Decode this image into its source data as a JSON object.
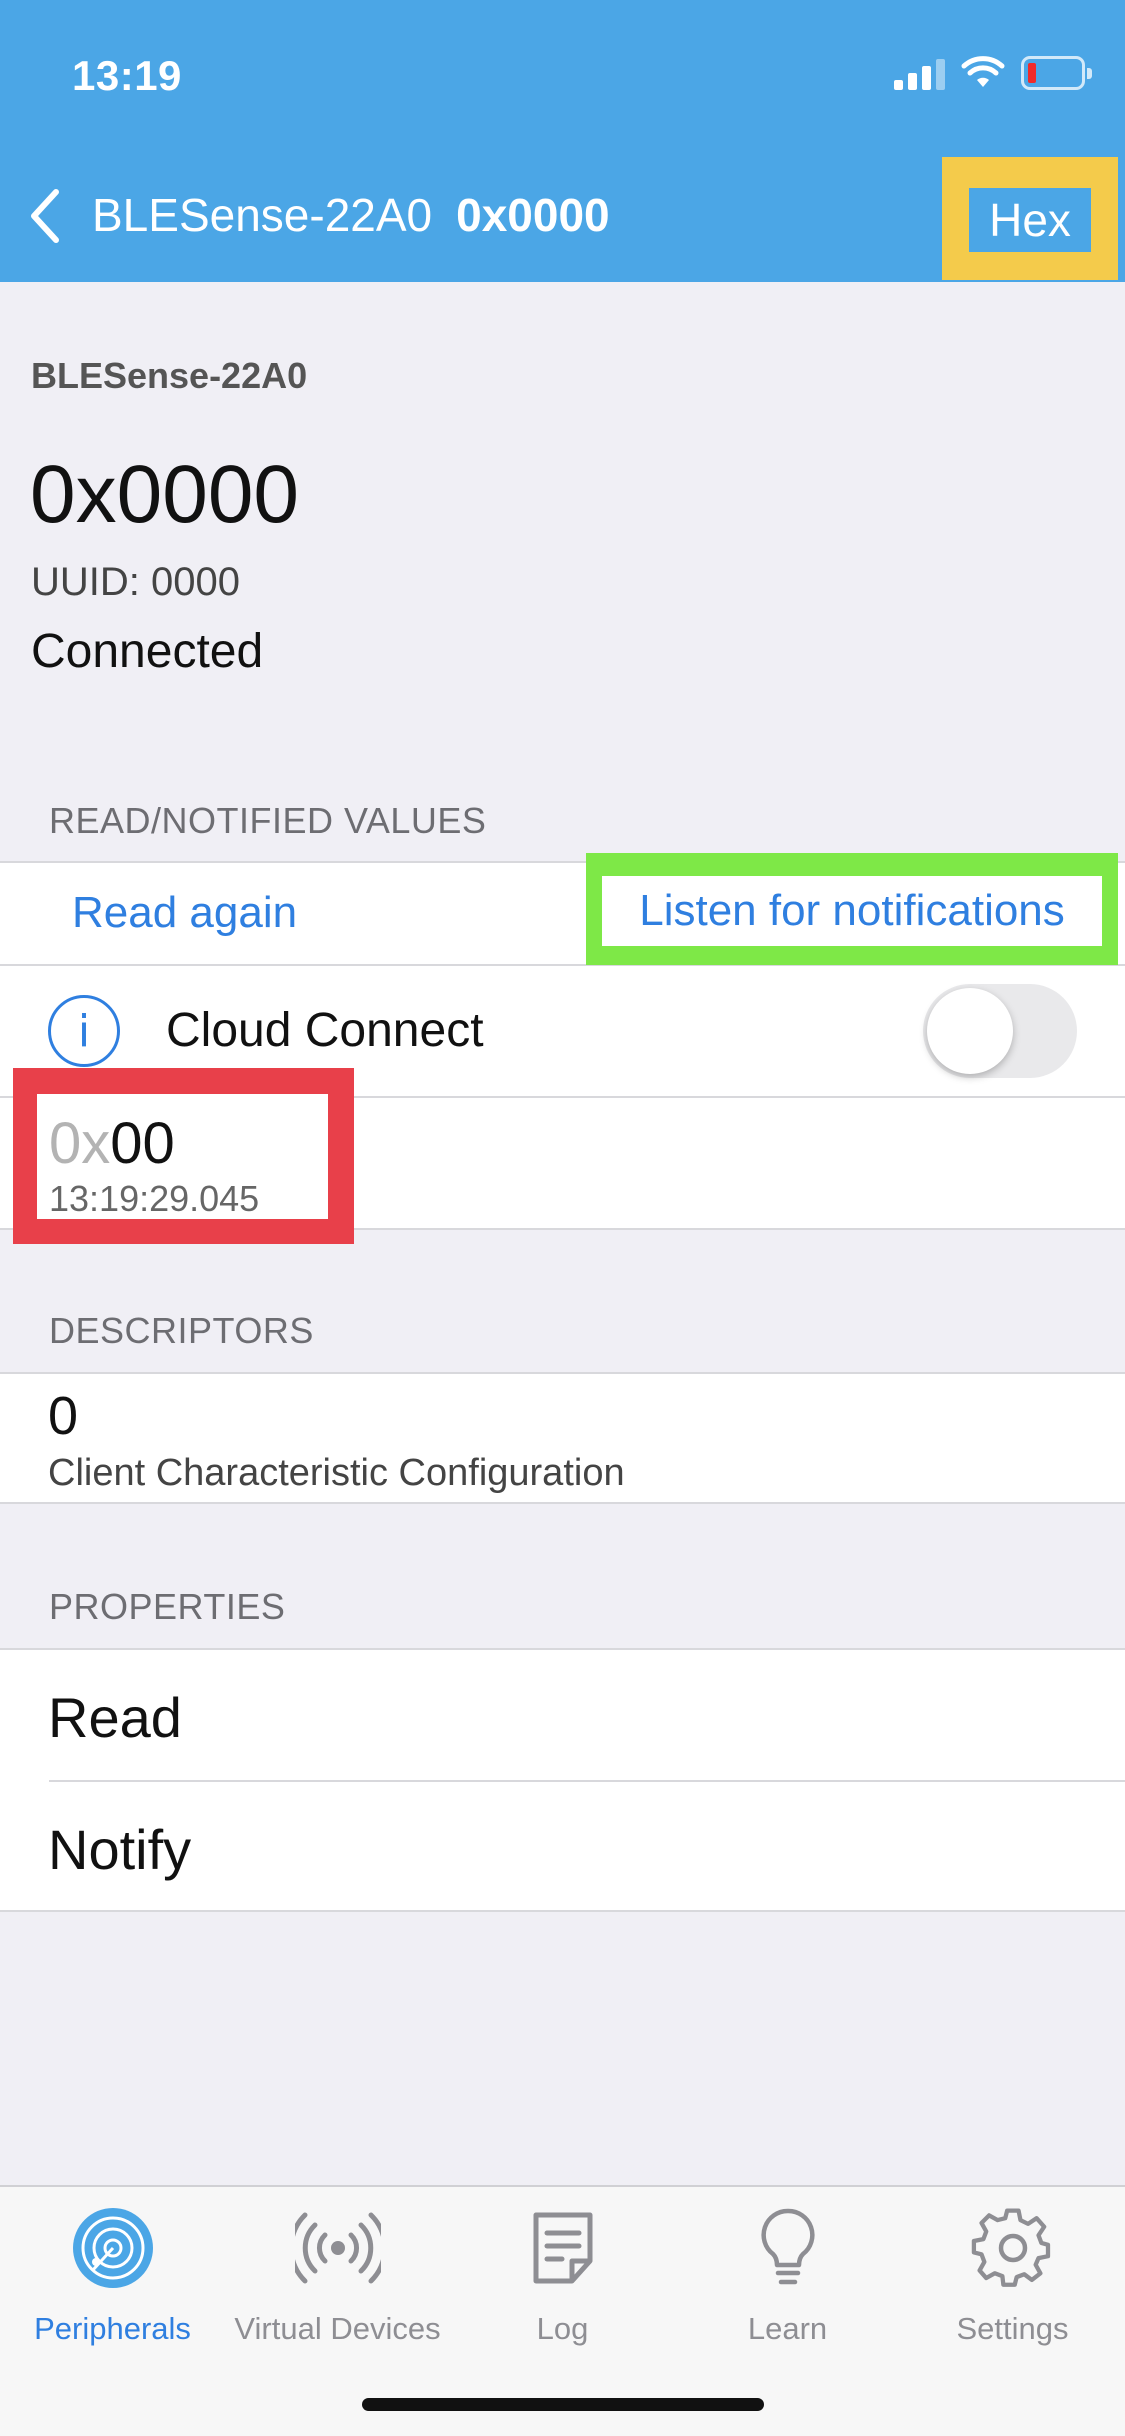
{
  "status_bar": {
    "time": "13:19"
  },
  "nav": {
    "device_name": "BLESense-22A0",
    "characteristic": "0x0000",
    "hex_label": "Hex"
  },
  "header": {
    "device_name": "BLESense-22A0",
    "characteristic": "0x0000",
    "uuid": "UUID: 0000",
    "state": "Connected"
  },
  "read_section": {
    "title": "READ/NOTIFIED VALUES",
    "read_again_label": "Read again",
    "listen_label": "Listen for notifications",
    "cloud_connect_label": "Cloud Connect",
    "cloud_connect_on": false,
    "value_prefix": "0x",
    "value": "00",
    "value_time": "13:19:29.045"
  },
  "descriptors": {
    "title": "DESCRIPTORS",
    "items": [
      {
        "name": "0",
        "detail": "Client Characteristic Configuration"
      }
    ]
  },
  "properties": {
    "title": "PROPERTIES",
    "items": [
      "Read",
      "Notify"
    ]
  },
  "tabbar": {
    "active": "Peripherals",
    "tabs": [
      {
        "label": "Peripherals",
        "icon": "peripherals-radar-icon"
      },
      {
        "label": "Virtual Devices",
        "icon": "broadcast-icon"
      },
      {
        "label": "Log",
        "icon": "log-note-icon"
      },
      {
        "label": "Learn",
        "icon": "lightbulb-icon"
      },
      {
        "label": "Settings",
        "icon": "gear-icon"
      }
    ]
  },
  "colors": {
    "nav_bar": "#4ba6e6",
    "accent": "#2f7fe0",
    "highlight_yellow": "#f4cb4b",
    "highlight_green": "#7ee847",
    "highlight_red": "#e8404a",
    "background": "#f0eff5"
  }
}
